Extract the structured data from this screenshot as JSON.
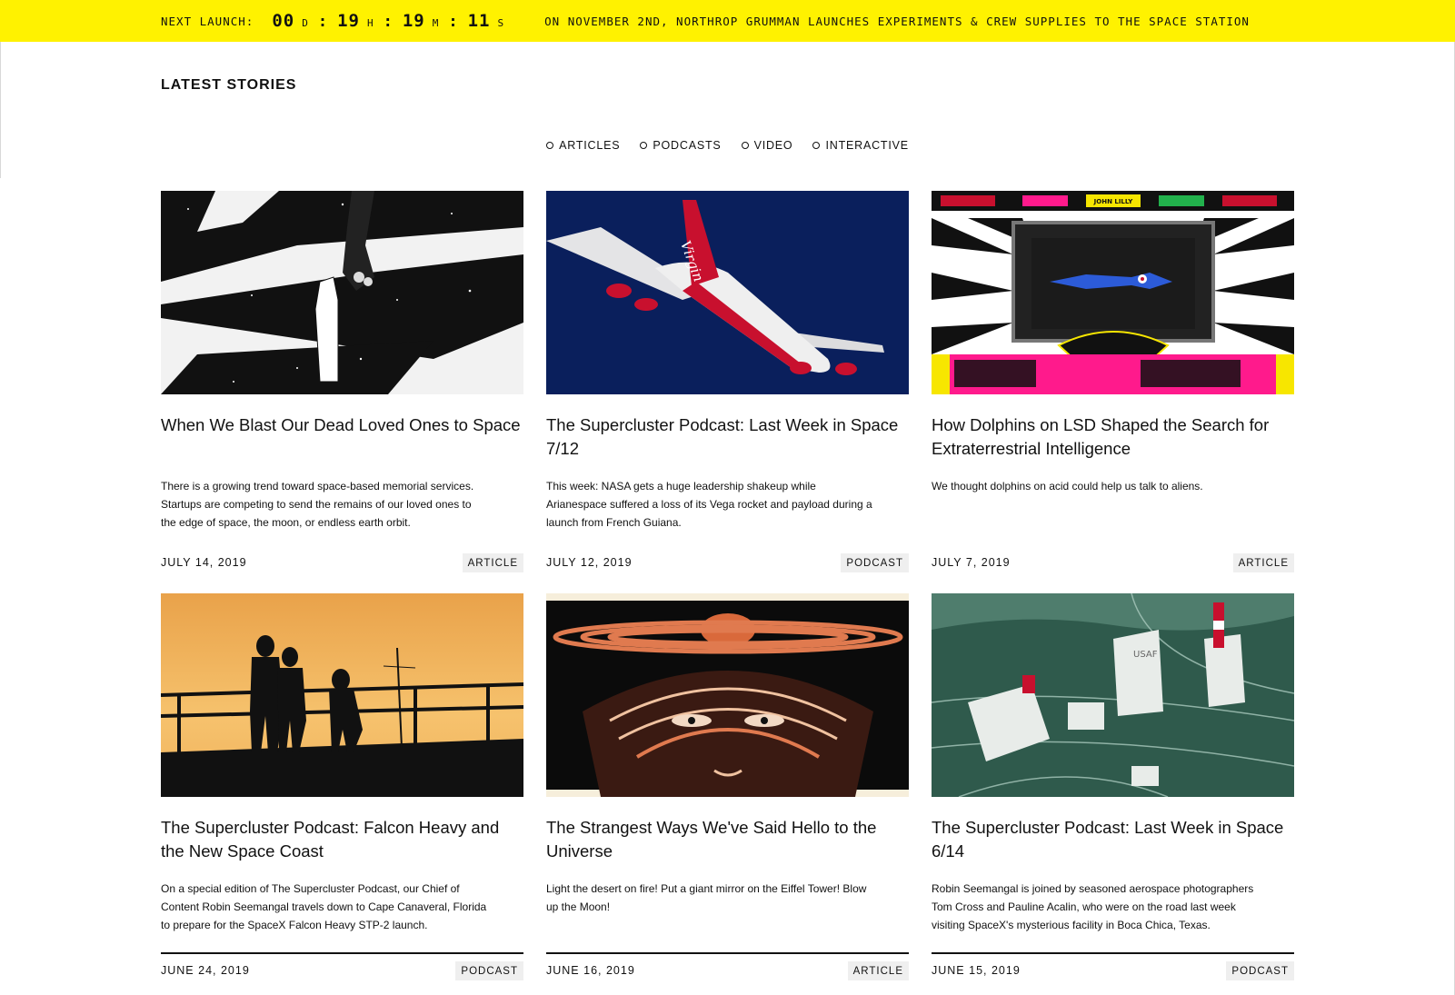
{
  "banner": {
    "label": "NEXT LAUNCH:",
    "countdown": [
      {
        "value": "00",
        "unit": "D"
      },
      {
        "value": "19",
        "unit": "H"
      },
      {
        "value": "19",
        "unit": "M"
      },
      {
        "value": "11",
        "unit": "S"
      }
    ],
    "news": "ON NOVEMBER 2ND, NORTHROP GRUMMAN LAUNCHES EXPERIMENTS & CREW SUPPLIES TO THE SPACE STATION"
  },
  "section_title": "LATEST STORIES",
  "filters": [
    "ARTICLES",
    "PODCASTS",
    "VIDEO",
    "INTERACTIVE"
  ],
  "cards": [
    {
      "title": "When We Blast Our Dead Loved Ones to Space",
      "description": "There is a growing trend toward space-based memorial services. Startups are competing to send the remains of our loved ones to the edge of space, the moon, or endless earth orbit.",
      "date": "JULY 14, 2019",
      "type": "ARTICLE",
      "image": "hands-reaching-space-illustration"
    },
    {
      "title": "The Supercluster Podcast: Last Week in Space 7/12",
      "description": "This week: NASA gets a huge leadership shakeup while Arianespace suffered a loss of its Vega rocket and payload during a launch from French Guiana.",
      "date": "JULY 12, 2019",
      "type": "PODCAST",
      "image": "virgin-747-airplane",
      "tail_text": "Virgin"
    },
    {
      "title": "How Dolphins on LSD Shaped the Search for Extraterrestrial Intelligence",
      "description": "We thought dolphins on acid could help us talk to aliens.",
      "date": "JULY 7, 2019",
      "type": "ARTICLE",
      "image": "john-lilly-psychedelic-illustration",
      "image_label": "JOHN LILLY"
    },
    {
      "title": "The Supercluster Podcast: Falcon Heavy and the New Space Coast",
      "description": "On a special edition of The Supercluster Podcast, our Chief of Content Robin Seemangal travels down to Cape Canaveral, Florida to prepare for the SpaceX Falcon Heavy STP-2 launch.",
      "date": "JUNE 24, 2019",
      "type": "PODCAST",
      "image": "silhouettes-at-sunset"
    },
    {
      "title": "The Strangest Ways We've Said Hello to the Universe",
      "description": "Light the desert on fire! Put a giant mirror on the Eiffel Tower! Blow up the Moon!",
      "date": "JUNE 16, 2019",
      "type": "ARTICLE",
      "image": "ringed-planet-face-illustration"
    },
    {
      "title": "The Supercluster Podcast: Last Week in Space 6/14",
      "description": "Robin Seemangal is joined by seasoned aerospace photographers Tom Cross and Pauline Acalin, who were on the road last week visiting SpaceX's mysterious facility in Boca Chica, Texas.",
      "date": "JUNE 15, 2019",
      "type": "PODCAST",
      "image": "launch-site-collage",
      "image_label": "USAF"
    }
  ]
}
